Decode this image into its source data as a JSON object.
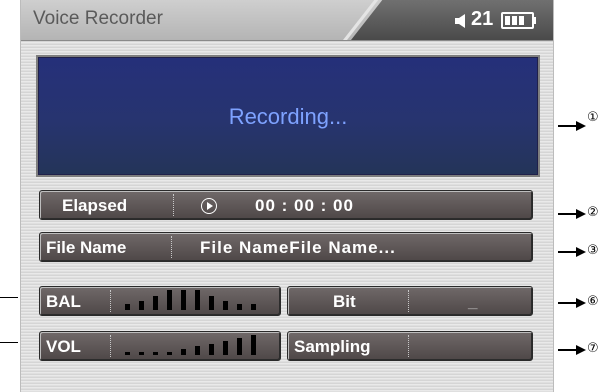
{
  "titlebar": {
    "title": "Voice Recorder",
    "volume": "21"
  },
  "screen": {
    "status": "Recording..."
  },
  "elapsed": {
    "label": "Elapsed",
    "time": "00 : 00 : 00"
  },
  "file": {
    "label": "File Name",
    "value": "File NameFile Name..."
  },
  "balance": {
    "label": "BAL",
    "levels": [
      2,
      3,
      5,
      7,
      7,
      7,
      5,
      3,
      2,
      2
    ]
  },
  "volume": {
    "label": "VOL",
    "levels": [
      1,
      1,
      1,
      1,
      2,
      3,
      4,
      5,
      6,
      7
    ]
  },
  "bit": {
    "label": "Bit",
    "value": "_"
  },
  "sampling": {
    "label": "Sampling",
    "value": ""
  },
  "callouts": [
    "①",
    "②",
    "③",
    "⑥",
    "⑦"
  ],
  "colors": {
    "screen": "#27346f",
    "screen_text": "#7ea2ff",
    "box": "#5e5757"
  }
}
